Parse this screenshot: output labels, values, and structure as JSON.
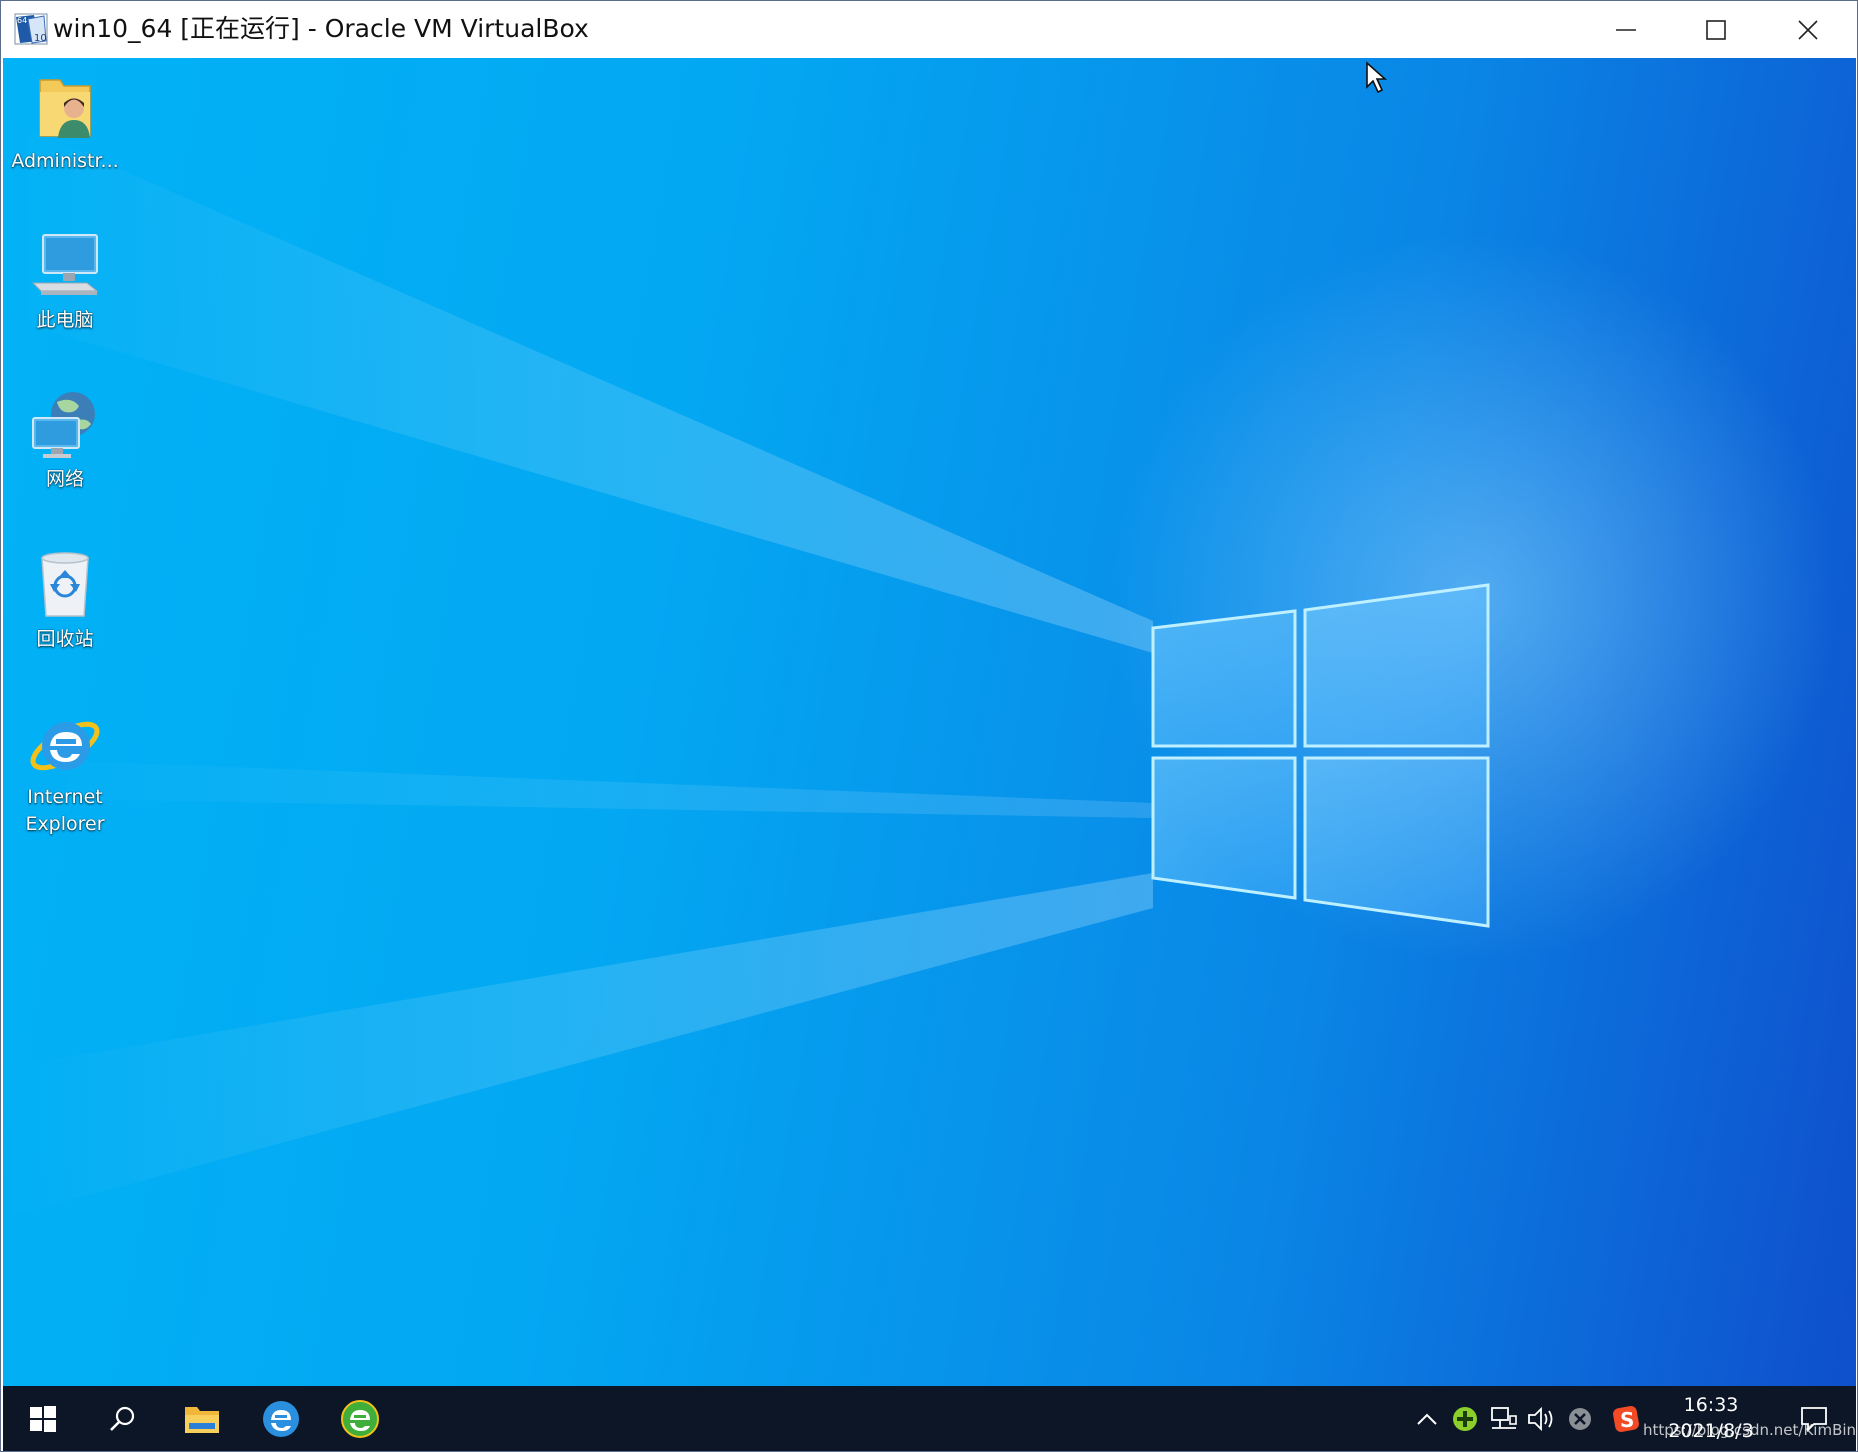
{
  "window": {
    "title": "win10_64 [正在运行] - Oracle VM VirtualBox",
    "icon": "virtualbox-win10-64-icon",
    "controls": {
      "minimize": "minimize-icon",
      "maximize": "maximize-icon",
      "close": "close-icon"
    }
  },
  "desktop": {
    "wallpaper": "windows-10-hero-logo",
    "icons": [
      {
        "label": "Administr...",
        "icon": "user-folder-icon"
      },
      {
        "label": "此电脑",
        "icon": "this-pc-icon"
      },
      {
        "label": "网络",
        "icon": "network-icon"
      },
      {
        "label": "回收站",
        "icon": "recycle-bin-icon"
      },
      {
        "label_line1": "Internet",
        "label_line2": "Explorer",
        "icon": "internet-explorer-icon"
      }
    ]
  },
  "taskbar": {
    "pinned": [
      {
        "name": "start",
        "icon": "windows-start-icon"
      },
      {
        "name": "search",
        "icon": "search-icon"
      },
      {
        "name": "file-explorer",
        "icon": "folder-icon"
      },
      {
        "name": "browser-e",
        "icon": "edge-legacy-icon"
      },
      {
        "name": "green-browser",
        "icon": "green-e-browser-icon"
      }
    ],
    "tray": {
      "icons": [
        "chevron-up-icon",
        "green-plus-icon",
        "network-tray-icon",
        "volume-icon",
        "x-circle-icon",
        "sogou-s-icon"
      ],
      "time": "16:33",
      "date": "2021/8/3",
      "notification_icon": "notification-icon"
    },
    "watermark": "https://blog.csdn.net/KimBing"
  },
  "colors": {
    "taskbar": "#0c1626",
    "wallpaper_light": "#03a8f2",
    "wallpaper_dark": "#0f4fcc"
  }
}
